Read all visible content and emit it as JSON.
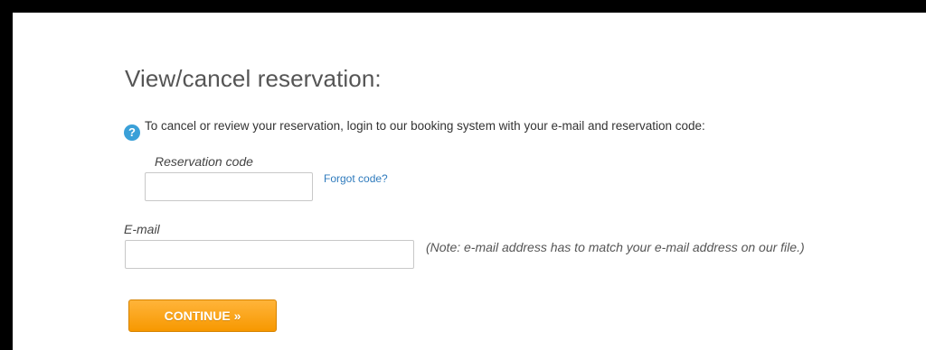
{
  "page": {
    "title": "View/cancel reservation:",
    "intro": "To cancel or review your reservation, login to our booking system with your e-mail and reservation code:",
    "help_icon": "?"
  },
  "form": {
    "code_label": "Reservation code",
    "code_value": "",
    "forgot_link": "Forgot code?",
    "email_label": "E-mail",
    "email_value": "",
    "email_note": "(Note: e-mail address has to match your e-mail address on our file.)",
    "continue_label": "CONTINUE »"
  },
  "colors": {
    "button": "#f79800",
    "link": "#2f7bbd",
    "help_icon": "#3aa0d8"
  }
}
